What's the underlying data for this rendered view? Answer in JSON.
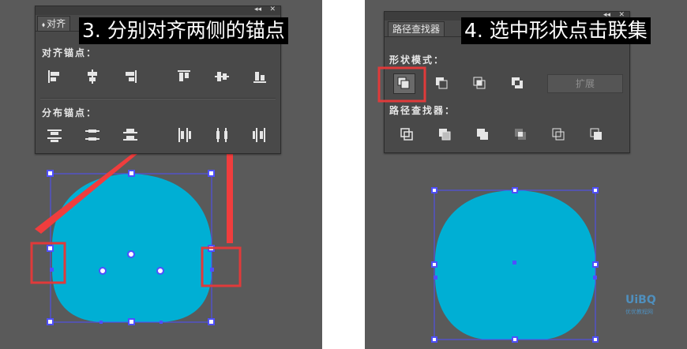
{
  "left": {
    "panel_tab": "对齐",
    "title": "3. 分别对齐两侧的锚点",
    "section_align": "对齐锚点：",
    "section_distribute": "分布锚点：",
    "align_icons": [
      "align-left-icon",
      "align-horizontal-center-icon",
      "align-right-icon",
      "align-top-icon",
      "align-vertical-center-icon",
      "align-bottom-icon"
    ],
    "distribute_icons": [
      "distribute-top-icon",
      "distribute-vertical-center-icon",
      "distribute-bottom-icon",
      "distribute-left-icon",
      "distribute-horizontal-center-icon",
      "distribute-right-icon"
    ]
  },
  "right": {
    "panel_tab": "路径查找器",
    "title": "4. 选中形状点击联集",
    "section_shape_modes": "形状模式：",
    "section_pathfinders": "路径查找器：",
    "expand_label": "扩展",
    "shape_mode_icons": [
      "unite-icon",
      "minus-front-icon",
      "intersect-icon",
      "exclude-icon"
    ],
    "pathfinder_icons": [
      "divide-icon",
      "trim-icon",
      "merge-icon",
      "crop-icon",
      "outline-icon",
      "minus-back-icon"
    ]
  },
  "panel_controls": {
    "collapse": "◂◂",
    "close": "✕"
  },
  "watermark": {
    "main": "UiBQ",
    "sub": "优优教程网"
  },
  "colors": {
    "shape": "#00afd4",
    "selection": "#4f4fff",
    "highlight": "#e03a3a",
    "arrow": "#f03d3d",
    "background": "#5a5a5a"
  }
}
